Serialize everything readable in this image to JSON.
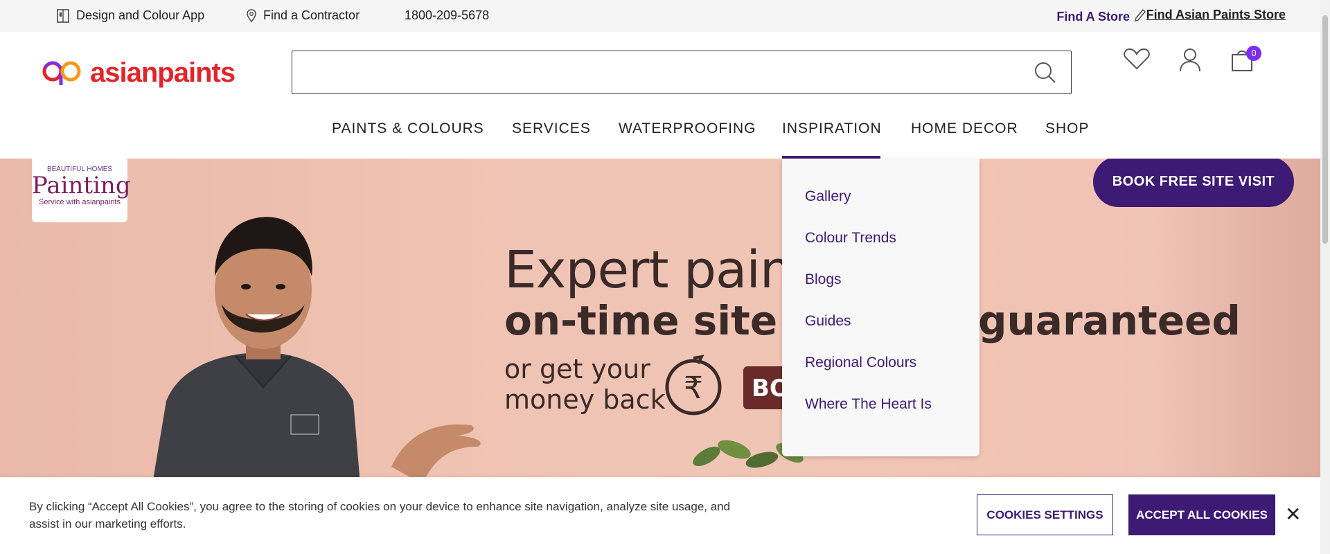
{
  "utility": {
    "app_label": "Design and Colour App",
    "contractor_label": "Find a Contractor",
    "phone": "1800-209-5678",
    "find_store": "Find A Store",
    "find_ap_store": "Find Asian Paints Store"
  },
  "header": {
    "logo_text": "asianpaints",
    "search_placeholder": "",
    "cart_count": "0"
  },
  "nav": {
    "items": [
      "PAINTS & COLOURS",
      "SERVICES",
      "WATERPROOFING",
      "INSPIRATION",
      "HOME DECOR",
      "SHOP"
    ],
    "active": "INSPIRATION"
  },
  "dropdown": {
    "items": [
      "Gallery",
      "Colour Trends",
      "Blogs",
      "Guides",
      "Regional Colours",
      "Where The Heart Is"
    ]
  },
  "hero": {
    "badge_small": "BEAUTIFUL HOMES",
    "badge_big": "Painting",
    "badge_service": "Service with asianpaints",
    "book_button": "BOOK FREE SITE VISIT",
    "headline1": "Expert paintin",
    "headline2": "on-time site co",
    "headline2b": "guaranteed",
    "subline1": "or get your",
    "subline2": "money back",
    "bo": "BO"
  },
  "cookie": {
    "text": "By clicking “Accept All Cookies”, you agree to the storing of cookies on your device to enhance site navigation, analyze site usage, and assist in our marketing efforts.",
    "settings_label": "COOKIES SETTINGS",
    "accept_label": "ACCEPT ALL COOKIES",
    "close_label": "✕"
  },
  "colors": {
    "brand_purple": "#3d1a73",
    "brand_red": "#e0262b",
    "hero_pink": "#f0c4b4"
  }
}
